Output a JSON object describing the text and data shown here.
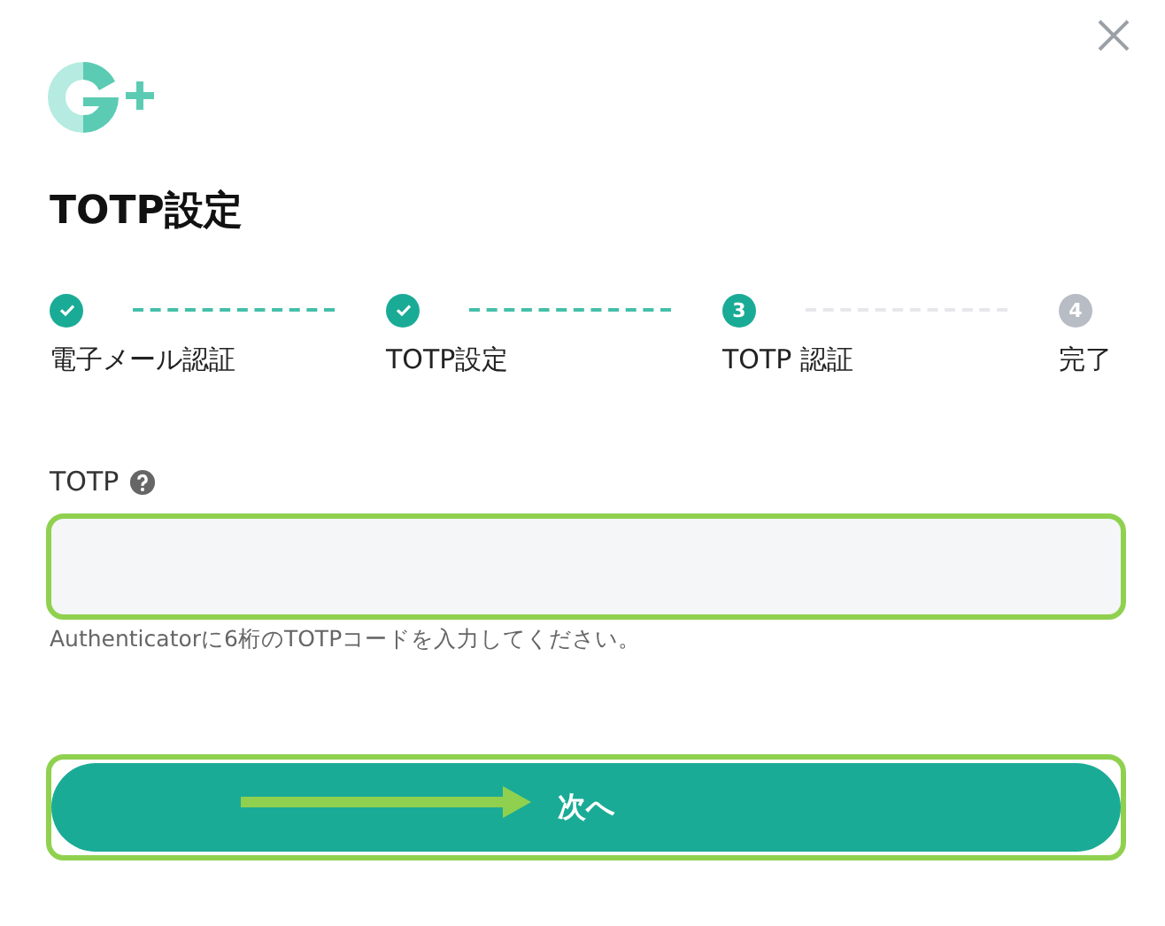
{
  "title": "TOTP設定",
  "steps": [
    {
      "label": "電子メール認証",
      "done": true
    },
    {
      "label": "TOTP設定",
      "done": true
    },
    {
      "label": "TOTP 認証",
      "done": false,
      "current": true,
      "number": "3"
    },
    {
      "label": "完了",
      "done": false,
      "current": false,
      "number": "4"
    }
  ],
  "field": {
    "label": "TOTP",
    "help": "Authenticatorに6桁のTOTPコードを入力してください。",
    "highlighted": true
  },
  "button": {
    "label": "次へ",
    "highlighted": true
  }
}
